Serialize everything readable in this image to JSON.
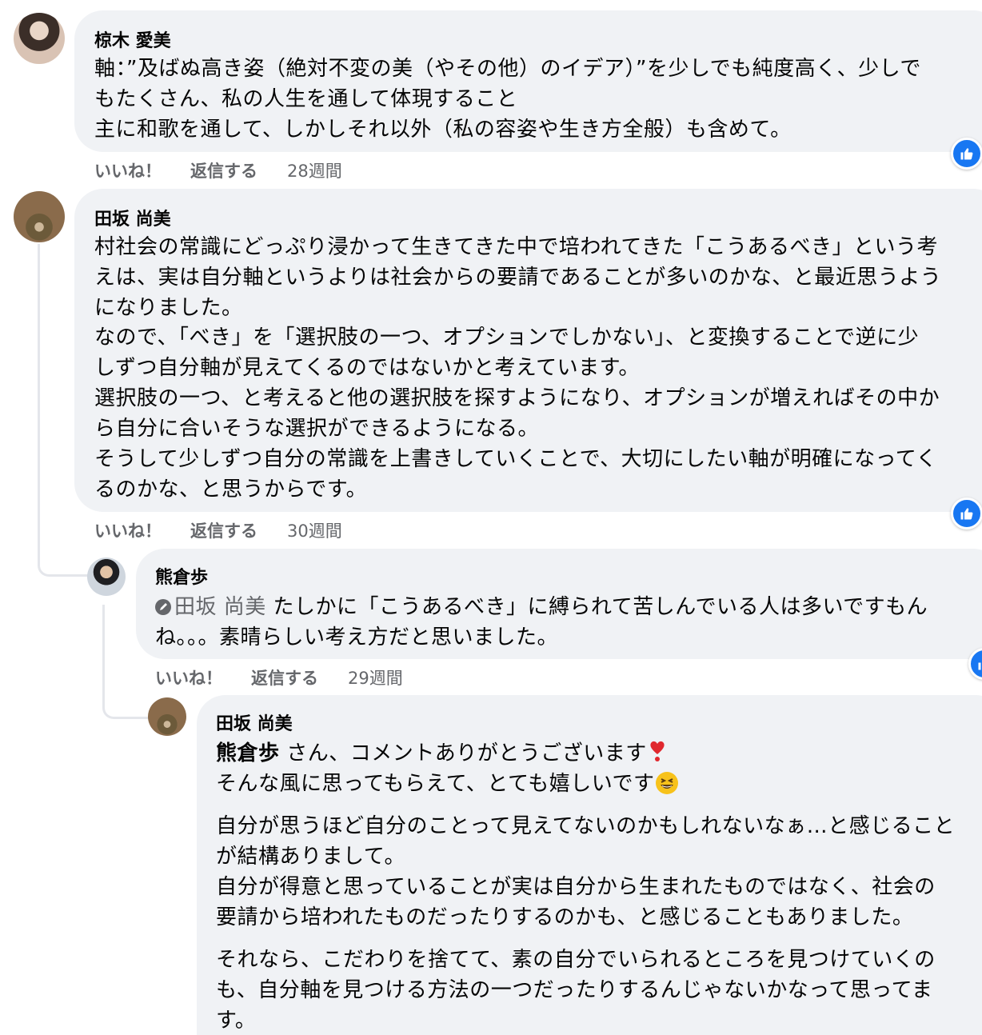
{
  "comments": [
    {
      "author": "椋木 愛美",
      "lines": [
        "軸：”及ばぬ高き姿（絶対不変の美（やその他）のイデア）”を少しでも純度高く、少しで",
        "もたくさん、私の人生を通して体現すること",
        "主に和歌を通して、しかしそれ以外（私の容姿や生き方全般）も含めて。"
      ],
      "like_label": "いいね！",
      "reply_label": "返信する",
      "time": "28週間"
    },
    {
      "author": "田坂 尚美",
      "lines": [
        "村社会の常識にどっぷり浸かって生きてきた中で培われてきた「こうあるべき」という考",
        "えは、実は自分軸というよりは社会からの要請であることが多いのかな、と最近思うよう",
        "になりました。",
        "なので、「べき」を「選択肢の一つ、オプションでしかない」、と変換することで逆に少",
        "しずつ自分軸が見えてくるのではないかと考えています。",
        "選択肢の一つ、と考えると他の選択肢を探すようになり、オプションが増えればその中か",
        "ら自分に合いそうな選択ができるようになる。",
        "そうして少しずつ自分の常識を上書きしていくことで、大切にしたい軸が明確になってく",
        "るのかな、と思うからです。"
      ],
      "like_label": "いいね！",
      "reply_label": "返信する",
      "time": "30週間"
    },
    {
      "author": "熊倉歩",
      "mention": "田坂 尚美",
      "lines": [
        "たしかに「こうあるべき」に縛られて苦しんでいる人は多いですもん",
        "ね。。。素晴らしい考え方だと思いました。"
      ],
      "like_label": "いいね！",
      "reply_label": "返信する",
      "time": "29週間"
    },
    {
      "author": "田坂 尚美",
      "mention": "熊倉歩",
      "lines": [
        "さん、コメントありがとうございます",
        "そんな風に思ってもらえて、とても嬉しいです",
        "自分が思うほど自分のことって見えてないのかもしれないなぁ…と感じること",
        "が結構ありまして。",
        "自分が得意と思っていることが実は自分から生まれたものではなく、社会の",
        "要請から培われたものだったりするのかも、と感じることもありました。",
        "それなら、こだわりを捨てて、素の自分でいられるところを見つけていくの",
        "も、自分軸を見つける方法の一つだったりするんじゃないかなって思ってま",
        "す。"
      ]
    }
  ],
  "colors": {
    "bubble": "#f0f2f5",
    "meta_text": "#65676b",
    "like_blue": "#1877f2"
  },
  "icons": [
    "like-reaction-icon",
    "pencil-mention-icon",
    "heavy-heart-exclamation-emoji",
    "grinning-squinting-face-emoji"
  ]
}
